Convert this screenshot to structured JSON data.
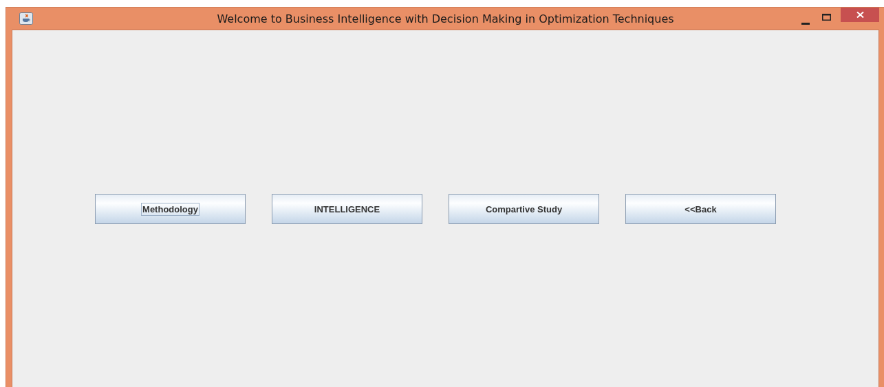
{
  "window": {
    "title": "Welcome to Business Intelligence with Decision Making in Optimization Techniques"
  },
  "buttons": [
    {
      "label": "Methodology",
      "focused": true
    },
    {
      "label": "INTELLIGENCE",
      "focused": false
    },
    {
      "label": "Compartive Study",
      "focused": false
    },
    {
      "label": "<<Back",
      "focused": false
    }
  ]
}
